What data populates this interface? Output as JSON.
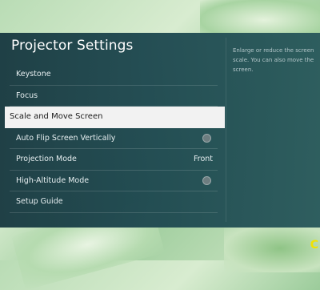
{
  "title": "Projector Settings",
  "menu": {
    "items": [
      {
        "label": "Keystone"
      },
      {
        "label": "Focus"
      },
      {
        "label": "Scale and Move Screen"
      },
      {
        "label": "Auto Flip Screen Vertically"
      },
      {
        "label": "Projection Mode",
        "value": "Front"
      },
      {
        "label": "High-Altitude Mode"
      },
      {
        "label": "Setup Guide"
      }
    ]
  },
  "help_text": "Enlarge or reduce the screen scale. You can also move the screen.",
  "corner_glyph": "C"
}
